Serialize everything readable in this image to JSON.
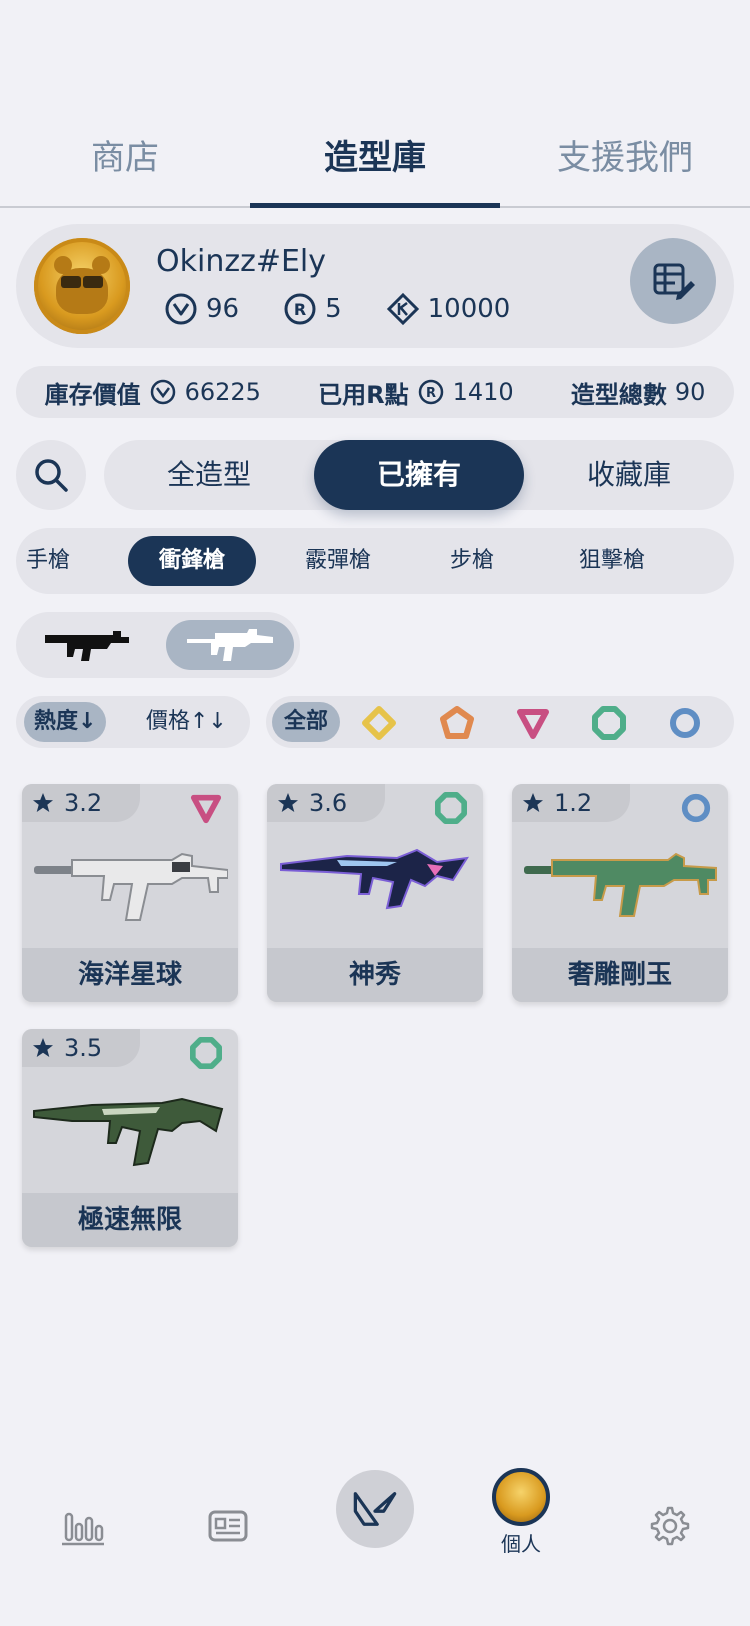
{
  "top_tabs": [
    "商店",
    "造型庫",
    "支援我們"
  ],
  "profile": {
    "username": "Okinzz#Ely",
    "vp": "96",
    "rp": "5",
    "kc": "10000",
    "edit_icon": "grid-edit-icon"
  },
  "summary": {
    "inventory_label": "庫存價值",
    "inventory_value": "66225",
    "used_rp_label": "已用R點",
    "used_rp_value": "1410",
    "skins_total_label": "造型總數",
    "skins_total_value": "90"
  },
  "segments": [
    "全造型",
    "已擁有",
    "收藏庫"
  ],
  "categories": [
    "手槍",
    "衝鋒槍",
    "霰彈槍",
    "步槍",
    "狙擊槍"
  ],
  "sort": {
    "popularity": "熱度↓",
    "price": "價格↑↓"
  },
  "rarity": {
    "all_label": "全部",
    "colors": {
      "select": "#e6c34a",
      "deluxe": "#e0894f",
      "premium": "#c84f82",
      "exclusive": "#4fae8a",
      "ultra": "#5f8ec4"
    }
  },
  "skins": [
    {
      "rating": "3.2",
      "name": "海洋星球",
      "tier": "premium"
    },
    {
      "rating": "3.6",
      "name": "神秀",
      "tier": "exclusive"
    },
    {
      "rating": "1.2",
      "name": "奢雕剛玉",
      "tier": "ultra"
    },
    {
      "rating": "3.5",
      "name": "極速無限",
      "tier": "exclusive"
    }
  ],
  "bottom_nav": {
    "profile_label": "個人"
  }
}
